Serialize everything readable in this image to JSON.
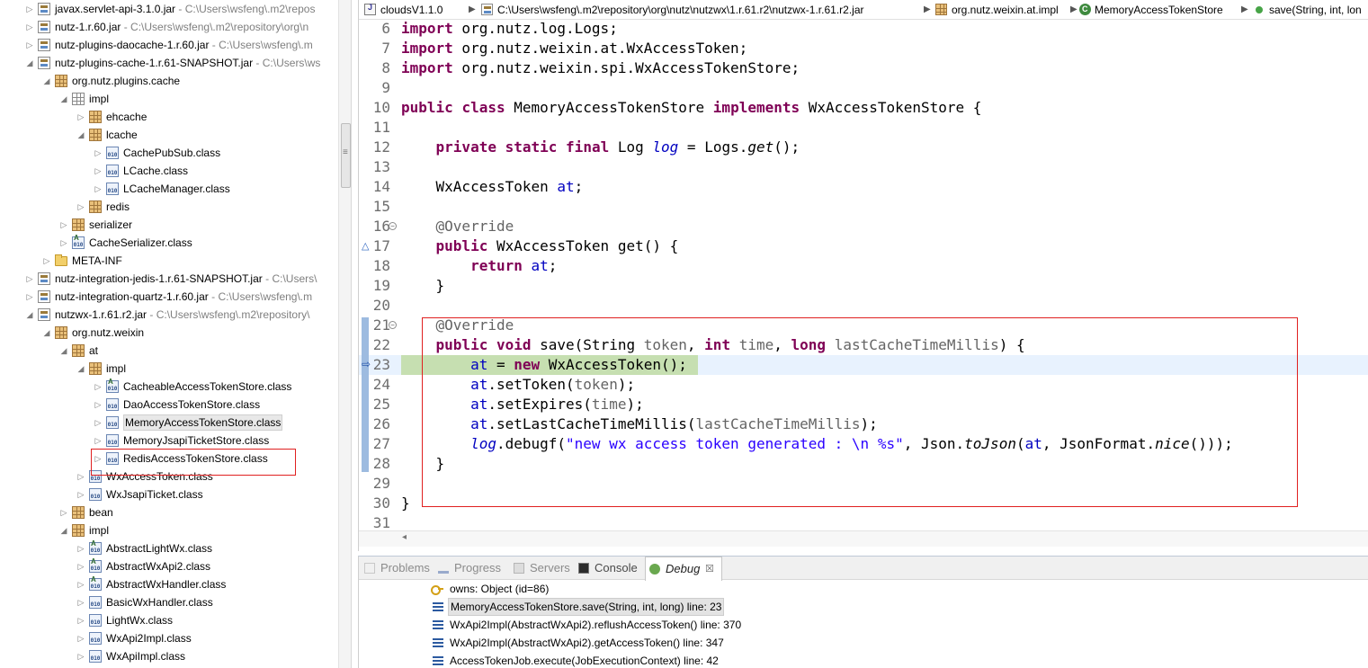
{
  "tree": {
    "rows": [
      {
        "label": "javax.servlet-api-3.1.0.jar",
        "path": "C:\\Users\\wsfeng\\.m2\\repos",
        "icon": "jar-icon",
        "toggle": "▷"
      },
      {
        "label": "nutz-1.r.60.jar",
        "path": "C:\\Users\\wsfeng\\.m2\\repository\\org\\n",
        "icon": "jar-icon",
        "toggle": "▷"
      },
      {
        "label": "nutz-plugins-daocache-1.r.60.jar",
        "path": "C:\\Users\\wsfeng\\.m",
        "icon": "jar-icon",
        "toggle": "▷"
      },
      {
        "label": "nutz-plugins-cache-1.r.61-SNAPSHOT.jar",
        "path": "C:\\Users\\ws",
        "icon": "jar-icon",
        "toggle": "◢"
      },
      {
        "label": "org.nutz.plugins.cache",
        "path": "",
        "icon": "package-icon",
        "toggle": "◢"
      },
      {
        "label": "impl",
        "path": "",
        "icon": "package-empty-icon",
        "toggle": "◢"
      },
      {
        "label": "ehcache",
        "path": "",
        "icon": "package-icon",
        "toggle": "▷"
      },
      {
        "label": "lcache",
        "path": "",
        "icon": "package-icon",
        "toggle": "◢"
      },
      {
        "label": "CachePubSub.class",
        "path": "",
        "icon": "class-file-icon",
        "toggle": "▷"
      },
      {
        "label": "LCache.class",
        "path": "",
        "icon": "class-file-icon",
        "toggle": "▷"
      },
      {
        "label": "LCacheManager.class",
        "path": "",
        "icon": "class-file-icon",
        "toggle": "▷"
      },
      {
        "label": "redis",
        "path": "",
        "icon": "package-icon",
        "toggle": "▷"
      },
      {
        "label": "serializer",
        "path": "",
        "icon": "package-icon",
        "toggle": "▷"
      },
      {
        "label": "CacheSerializer.class",
        "path": "",
        "icon": "abstract-class-file-icon",
        "toggle": "▷"
      },
      {
        "label": "META-INF",
        "path": "",
        "icon": "folder-icon",
        "toggle": "▷"
      },
      {
        "label": "nutz-integration-jedis-1.r.61-SNAPSHOT.jar",
        "path": "C:\\Users\\",
        "icon": "jar-icon",
        "toggle": "▷"
      },
      {
        "label": "nutz-integration-quartz-1.r.60.jar",
        "path": "C:\\Users\\wsfeng\\.m",
        "icon": "jar-icon",
        "toggle": "▷"
      },
      {
        "label": "nutzwx-1.r.61.r2.jar",
        "path": "C:\\Users\\wsfeng\\.m2\\repository\\",
        "icon": "jar-icon",
        "toggle": "◢"
      },
      {
        "label": "org.nutz.weixin",
        "path": "",
        "icon": "package-icon",
        "toggle": "◢"
      },
      {
        "label": "at",
        "path": "",
        "icon": "package-icon",
        "toggle": "◢"
      },
      {
        "label": "impl",
        "path": "",
        "icon": "package-icon",
        "toggle": "◢"
      },
      {
        "label": "CacheableAccessTokenStore.class",
        "path": "",
        "icon": "abstract-class-file-icon",
        "toggle": "▷"
      },
      {
        "label": "DaoAccessTokenStore.class",
        "path": "",
        "icon": "class-file-icon",
        "toggle": "▷"
      },
      {
        "label": "MemoryAccessTokenStore.class",
        "path": "",
        "icon": "class-file-icon",
        "toggle": "▷"
      },
      {
        "label": "MemoryJsapiTicketStore.class",
        "path": "",
        "icon": "class-file-icon",
        "toggle": "▷"
      },
      {
        "label": "RedisAccessTokenStore.class",
        "path": "",
        "icon": "class-file-icon",
        "toggle": "▷"
      },
      {
        "label": "WxAccessToken.class",
        "path": "",
        "icon": "class-file-icon",
        "toggle": "▷"
      },
      {
        "label": "WxJsapiTicket.class",
        "path": "",
        "icon": "class-file-icon",
        "toggle": "▷"
      },
      {
        "label": "bean",
        "path": "",
        "icon": "package-icon",
        "toggle": "▷"
      },
      {
        "label": "impl",
        "path": "",
        "icon": "package-icon",
        "toggle": "◢"
      },
      {
        "label": "AbstractLightWx.class",
        "path": "",
        "icon": "abstract-class-file-icon",
        "toggle": "▷"
      },
      {
        "label": "AbstractWxApi2.class",
        "path": "",
        "icon": "abstract-class-file-icon",
        "toggle": "▷"
      },
      {
        "label": "AbstractWxHandler.class",
        "path": "",
        "icon": "abstract-class-file-icon",
        "toggle": "▷"
      },
      {
        "label": "BasicWxHandler.class",
        "path": "",
        "icon": "class-file-icon",
        "toggle": "▷"
      },
      {
        "label": "LightWx.class",
        "path": "",
        "icon": "class-file-icon",
        "toggle": "▷"
      },
      {
        "label": "WxApi2Impl.class",
        "path": "",
        "icon": "class-file-icon",
        "toggle": "▷"
      },
      {
        "label": "WxApiImpl.class",
        "path": "",
        "icon": "class-file-icon",
        "toggle": "▷"
      }
    ]
  },
  "breadcrumb": {
    "project": "cloudsV1.1.0",
    "jar": "C:\\Users\\wsfeng\\.m2\\repository\\org\\nutz\\nutzwx\\1.r.61.r2\\nutzwx-1.r.61.r2.jar",
    "package": "org.nutz.weixin.at.impl",
    "class": "MemoryAccessTokenStore",
    "method": "save(String, int, lon"
  },
  "editor": {
    "lines": [
      {
        "n": "6",
        "tokens": [
          [
            "kw",
            "import"
          ],
          [
            "",
            "&#32;org.nutz.log.Logs;"
          ]
        ]
      },
      {
        "n": "7",
        "tokens": [
          [
            "kw",
            "import"
          ],
          [
            "",
            "&#32;org.nutz.weixin.at.WxAccessToken;"
          ]
        ]
      },
      {
        "n": "8",
        "tokens": [
          [
            "kw",
            "import"
          ],
          [
            "",
            "&#32;org.nutz.weixin.spi.WxAccessTokenStore;"
          ]
        ]
      },
      {
        "n": "9",
        "tokens": []
      },
      {
        "n": "10",
        "tokens": [
          [
            "kw",
            "public"
          ],
          [
            "",
            "&#32;"
          ],
          [
            "kw",
            "class"
          ],
          [
            "",
            "&#32;MemoryAccessTokenStore&#32;"
          ],
          [
            "kw",
            "implements"
          ],
          [
            "",
            "&#32;WxAccessTokenStore&#32;{"
          ]
        ]
      },
      {
        "n": "11",
        "tokens": []
      },
      {
        "n": "12",
        "tokens": [
          [
            "",
            "&#32;&#32;&#32;&#32;"
          ],
          [
            "kw",
            "private"
          ],
          [
            "",
            "&#32;"
          ],
          [
            "kw",
            "static"
          ],
          [
            "",
            "&#32;"
          ],
          [
            "kw",
            "final"
          ],
          [
            "",
            "&#32;Log&#32;"
          ],
          [
            "fld it",
            "log"
          ],
          [
            "",
            "&#32;=&#32;Logs."
          ],
          [
            "it",
            "get"
          ],
          [
            "",
            "();"
          ]
        ]
      },
      {
        "n": "13",
        "tokens": []
      },
      {
        "n": "14",
        "tokens": [
          [
            "",
            "&#32;&#32;&#32;&#32;WxAccessToken&#32;"
          ],
          [
            "fld",
            "at"
          ],
          [
            "",
            ";"
          ]
        ]
      },
      {
        "n": "15",
        "tokens": []
      },
      {
        "n": "16",
        "tokens": [
          [
            "",
            "&#32;&#32;&#32;&#32;"
          ],
          [
            "ann",
            "@Override"
          ]
        ]
      },
      {
        "n": "17",
        "tokens": [
          [
            "",
            "&#32;&#32;&#32;&#32;"
          ],
          [
            "kw",
            "public"
          ],
          [
            "",
            "&#32;WxAccessToken&#32;get()&#32;{"
          ]
        ]
      },
      {
        "n": "18",
        "tokens": [
          [
            "",
            "&#32;&#32;&#32;&#32;&#32;&#32;&#32;&#32;"
          ],
          [
            "kw",
            "return"
          ],
          [
            "",
            "&#32;"
          ],
          [
            "fld",
            "at"
          ],
          [
            "",
            ";"
          ]
        ]
      },
      {
        "n": "19",
        "tokens": [
          [
            "",
            "&#32;&#32;&#32;&#32;}"
          ]
        ]
      },
      {
        "n": "20",
        "tokens": []
      },
      {
        "n": "21",
        "tokens": [
          [
            "",
            "&#32;&#32;&#32;&#32;"
          ],
          [
            "ann",
            "@Override"
          ]
        ]
      },
      {
        "n": "22",
        "tokens": [
          [
            "",
            "&#32;&#32;&#32;&#32;"
          ],
          [
            "kw",
            "public"
          ],
          [
            "",
            "&#32;"
          ],
          [
            "kw",
            "void"
          ],
          [
            "",
            "&#32;save(String&#32;"
          ],
          [
            "ann",
            "token"
          ],
          [
            "",
            ",&#32;"
          ],
          [
            "kw",
            "int"
          ],
          [
            "",
            "&#32;"
          ],
          [
            "ann",
            "time"
          ],
          [
            "",
            ",&#32;"
          ],
          [
            "kw",
            "long"
          ],
          [
            "",
            "&#32;"
          ],
          [
            "ann",
            "lastCacheTimeMillis"
          ],
          [
            "",
            ")&#32;{"
          ]
        ]
      },
      {
        "n": "23",
        "tokens": [
          [
            "",
            "&#32;&#32;&#32;&#32;&#32;&#32;&#32;&#32;"
          ],
          [
            "fld",
            "at"
          ],
          [
            "",
            "&#32;=&#32;"
          ],
          [
            "kw",
            "new"
          ],
          [
            "",
            "&#32;WxAccessToken();"
          ]
        ]
      },
      {
        "n": "24",
        "tokens": [
          [
            "",
            "&#32;&#32;&#32;&#32;&#32;&#32;&#32;&#32;"
          ],
          [
            "fld",
            "at"
          ],
          [
            "",
            ".setToken("
          ],
          [
            "ann",
            "token"
          ],
          [
            "",
            ");"
          ]
        ]
      },
      {
        "n": "25",
        "tokens": [
          [
            "",
            "&#32;&#32;&#32;&#32;&#32;&#32;&#32;&#32;"
          ],
          [
            "fld",
            "at"
          ],
          [
            "",
            ".setExpires("
          ],
          [
            "ann",
            "time"
          ],
          [
            "",
            ");"
          ]
        ]
      },
      {
        "n": "26",
        "tokens": [
          [
            "",
            "&#32;&#32;&#32;&#32;&#32;&#32;&#32;&#32;"
          ],
          [
            "fld",
            "at"
          ],
          [
            "",
            ".setLastCacheTimeMillis("
          ],
          [
            "ann",
            "lastCacheTimeMillis"
          ],
          [
            "",
            ");"
          ]
        ]
      },
      {
        "n": "27",
        "tokens": [
          [
            "",
            "&#32;&#32;&#32;&#32;&#32;&#32;&#32;&#32;"
          ],
          [
            "fld it",
            "log"
          ],
          [
            "",
            ".debugf("
          ],
          [
            "str",
            "\"new&#32;wx&#32;access&#32;token&#32;generated&#32;:&#32;\\n&#32;%s\""
          ],
          [
            "",
            ",&#32;Json."
          ],
          [
            "it",
            "toJson"
          ],
          [
            "",
            "("
          ],
          [
            "fld",
            "at"
          ],
          [
            "",
            ",&#32;JsonFormat."
          ],
          [
            "it",
            "nice"
          ],
          [
            "",
            "()));"
          ]
        ]
      },
      {
        "n": "28",
        "tokens": [
          [
            "",
            "&#32;&#32;&#32;&#32;}"
          ]
        ]
      },
      {
        "n": "29",
        "tokens": []
      },
      {
        "n": "30",
        "tokens": [
          [
            "",
            "}"
          ]
        ]
      },
      {
        "n": "31",
        "tokens": []
      }
    ]
  },
  "bottom": {
    "tabs": [
      {
        "label": "Problems",
        "icon": "problems-icon"
      },
      {
        "label": "Progress",
        "icon": "progress-icon"
      },
      {
        "label": "Servers",
        "icon": "servers-icon"
      },
      {
        "label": "Console",
        "icon": "console-icon"
      },
      {
        "label": "Debug",
        "icon": "debug-icon"
      }
    ],
    "close": "☒",
    "debug_rows": [
      {
        "text": "owns: Object  (id=86)",
        "icon": "key-icon"
      },
      {
        "text": "MemoryAccessTokenStore.save(String, int, long) line: 23",
        "icon": "stack-frame-icon"
      },
      {
        "text": "WxApi2Impl(AbstractWxApi2).reflushAccessToken() line: 370",
        "icon": "stack-frame-icon"
      },
      {
        "text": "WxApi2Impl(AbstractWxApi2).getAccessToken() line: 347",
        "icon": "stack-frame-icon"
      },
      {
        "text": "AccessTokenJob.execute(JobExecutionContext) line: 42",
        "icon": "stack-frame-icon"
      }
    ]
  }
}
